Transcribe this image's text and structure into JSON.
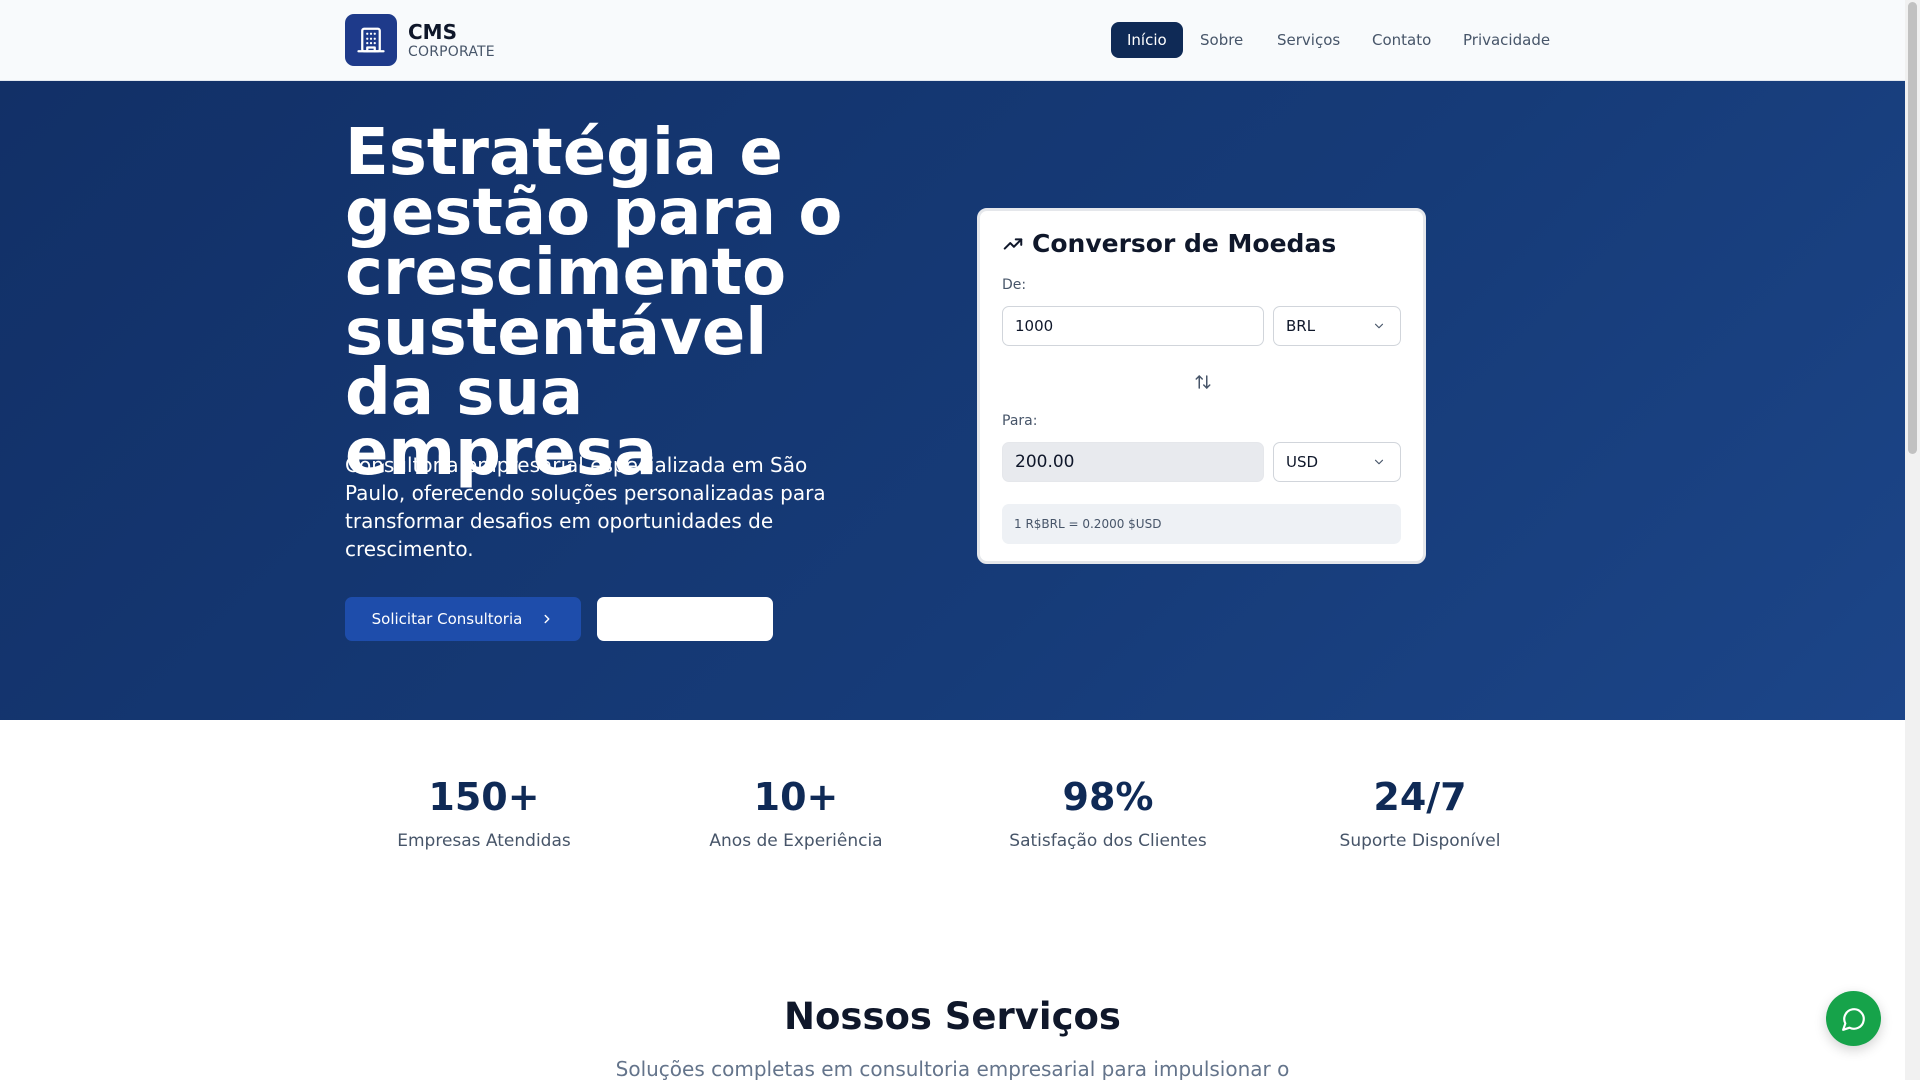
{
  "header": {
    "brand_name": "CMS",
    "brand_sub": "CORPORATE",
    "nav": [
      {
        "label": "Início",
        "active": true
      },
      {
        "label": "Sobre",
        "active": false
      },
      {
        "label": "Serviços",
        "active": false
      },
      {
        "label": "Contato",
        "active": false
      },
      {
        "label": "Privacidade",
        "active": false
      }
    ]
  },
  "hero": {
    "title_lines": [
      "Estratégia e",
      "gestão para o",
      "crescimento",
      "sustentável",
      "da sua empresa"
    ],
    "description": "Consultoria empresarial especializada em São Paulo, oferecendo soluções personalizadas para transformar desafios em oportunidades de crescimento.",
    "primary_button": "Solicitar Consultoria",
    "secondary_button": ""
  },
  "converter": {
    "title": "Conversor de Moedas",
    "from_label": "De:",
    "from_value": "1000",
    "from_currency": "BRL",
    "to_label": "Para:",
    "to_value": "200.00",
    "to_currency": "USD",
    "rate_text": "1 R$BRL = 0.2000 $USD"
  },
  "stats": [
    {
      "value": "150+",
      "label": "Empresas Atendidas"
    },
    {
      "value": "10+",
      "label": "Anos de Experiência"
    },
    {
      "value": "98%",
      "label": "Satisfação dos Clientes"
    },
    {
      "value": "24/7",
      "label": "Suporte Disponível"
    }
  ],
  "services": {
    "title": "Nossos Serviços",
    "subtitle": "Soluções completas em consultoria empresarial para impulsionar o"
  },
  "colors": {
    "hero_bg": "#163b78",
    "primary": "#1e4dab",
    "nav_active": "#0f2a56",
    "stat_value": "#0f2a56",
    "chat_fab": "#16a34a"
  },
  "icons": {
    "logo": "building-icon",
    "card_title": "trending-up-icon",
    "swap": "swap-vertical-icon",
    "select": "chevron-down-icon",
    "button": "chevron-right-icon",
    "chat": "message-circle-icon"
  }
}
